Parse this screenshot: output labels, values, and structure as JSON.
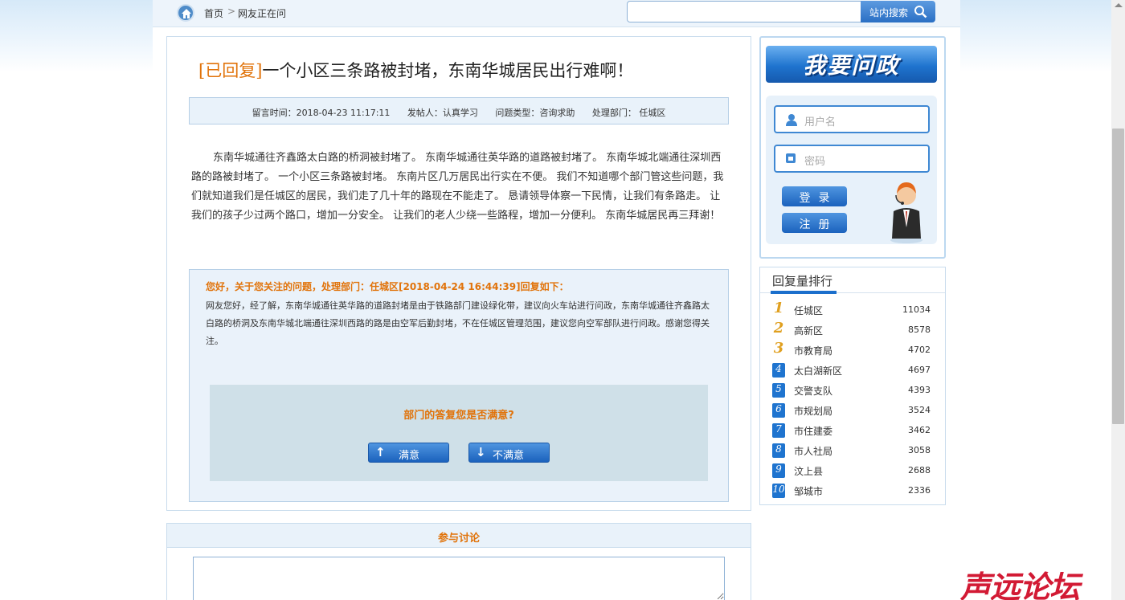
{
  "breadcrumb": {
    "home": "首页",
    "current": "网友正在问"
  },
  "search": {
    "button_label": "站内搜索",
    "value": ""
  },
  "article": {
    "status_tag": "[已回复]",
    "title": "一个小区三条路被封堵，东南华城居民出行难啊！",
    "meta": {
      "time": "留言时间：2018-04-23 11:17:11",
      "poster": "发帖人：认真学习",
      "type": "问题类型：咨询求助",
      "dept": "处理部门： 任城区"
    },
    "content": "东南华城通往齐鑫路太白路的桥洞被封堵了。 东南华城通往英华路的道路被封堵了。 东南华城北端通往深圳西路的路被封堵了。 一个小区三条路被封堵。 东南片区几万居民出行实在不便。 我们不知道哪个部门管这些问题，我们就知道我们是任城区的居民，我们走了几十年的路现在不能走了。 恳请领导体察一下民情，让我们有条路走。 让我们的孩子少过两个路口，增加一分安全。 让我们的老人少绕一些路程，增加一分便利。 东南华城居民再三拜谢！"
  },
  "reply": {
    "header": "您好，关于您关注的问题，处理部门：任城区[2018-04-24 16:44:39]回复如下：",
    "body": "网友您好，经了解，东南华城通往英华路的道路封堵是由于铁路部门建设绿化带，建议向火车站进行问政，东南华城通往齐鑫路太白路的桥洞及东南华城北端通往深圳西路的路是由空军后勤封堵，不在任城区管理范围，建议您向空军部队进行问政。感谢您得关注。",
    "satisfaction_question": "部门的答复您是否满意?",
    "satisfied_label": "满意",
    "unsatisfied_label": "不满意"
  },
  "discussion": {
    "title": "参与讨论"
  },
  "ask_panel": {
    "banner": "我要问政",
    "username_placeholder": "用户名",
    "password_placeholder": "密码",
    "login_label": "登录",
    "register_label": "注册"
  },
  "ranking": {
    "title": "回复量排行",
    "items": [
      {
        "rank": "1",
        "name": "任城区",
        "count": "11034"
      },
      {
        "rank": "2",
        "name": "高新区",
        "count": "8578"
      },
      {
        "rank": "3",
        "name": "市教育局",
        "count": "4702"
      },
      {
        "rank": "4",
        "name": "太白湖新区",
        "count": "4697"
      },
      {
        "rank": "5",
        "name": "交警支队",
        "count": "4393"
      },
      {
        "rank": "6",
        "name": "市规划局",
        "count": "3524"
      },
      {
        "rank": "7",
        "name": "市住建委",
        "count": "3462"
      },
      {
        "rank": "8",
        "name": "市人社局",
        "count": "3058"
      },
      {
        "rank": "9",
        "name": "汶上县",
        "count": "2688"
      },
      {
        "rank": "10",
        "name": "邹城市",
        "count": "2336"
      }
    ]
  },
  "watermark": "声远论坛",
  "colors": {
    "accent_orange": "#e1730a",
    "primary_blue": "#1f74cf",
    "panel_bg": "#e9f2fa"
  }
}
